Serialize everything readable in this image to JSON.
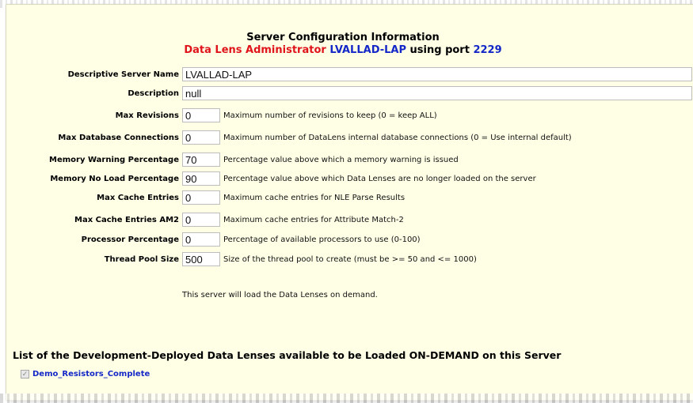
{
  "header": {
    "title": "Server Configuration Information",
    "app_name": "Data Lens Administrator",
    "server_name": "LVALLAD-LAP",
    "using_port": "using port",
    "port": "2229"
  },
  "fields": [
    {
      "label": "Descriptive Server Name",
      "value": "LVALLAD-LAP",
      "description": ""
    },
    {
      "label": "Description",
      "value": "null",
      "description": ""
    },
    {
      "label": "Max Revisions",
      "value": "0",
      "description": "Maximum number of revisions to keep (0 = keep ALL)"
    },
    {
      "label": "Max Database Connections",
      "value": "0",
      "description": "Maximum number of DataLens internal database connections (0 = Use internal default)"
    },
    {
      "label": "Memory Warning Percentage",
      "value": "70",
      "description": "Percentage value above which a memory warning is issued"
    },
    {
      "label": "Memory No Load Percentage",
      "value": "90",
      "description": "Percentage value above which Data Lenses are no longer loaded on the server"
    },
    {
      "label": "Max Cache Entries",
      "value": "0",
      "description": "Maximum cache entries for NLE Parse Results"
    },
    {
      "label": "Max Cache Entries AM2",
      "value": "0",
      "description": "Maximum cache entries for Attribute Match-2"
    },
    {
      "label": "Processor Percentage",
      "value": "0",
      "description": "Percentage of available processors to use (0-100)"
    },
    {
      "label": "Thread Pool Size",
      "value": "500",
      "description": "Size of the thread pool to create (must be >= 50 and <= 1000)"
    }
  ],
  "note": "This server will load the Data Lenses on demand.",
  "lens_list": {
    "title": "List of the Development-Deployed Data Lenses available to be Loaded ON-DEMAND on this Server",
    "items": [
      {
        "label": "Demo_Resistors_Complete",
        "checked": true
      }
    ]
  }
}
